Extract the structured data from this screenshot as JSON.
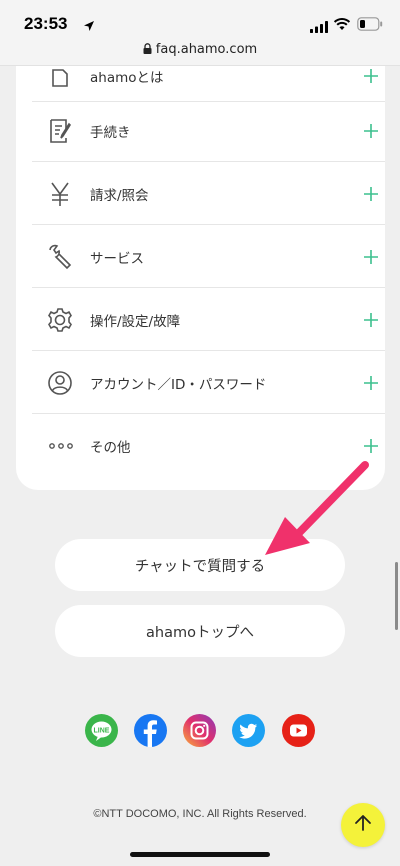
{
  "status": {
    "time": "23:53",
    "url": "faq.ahamo.com"
  },
  "menu": {
    "items": [
      {
        "label": "ahamoとは",
        "icon": "info-doc-icon"
      },
      {
        "label": "手続き",
        "icon": "form-icon"
      },
      {
        "label": "請求/照会",
        "icon": "yen-icon"
      },
      {
        "label": "サービス",
        "icon": "wrench-icon"
      },
      {
        "label": "操作/設定/故障",
        "icon": "gear-icon"
      },
      {
        "label": "アカウント／ID・パスワード",
        "icon": "user-icon"
      },
      {
        "label": "その他",
        "icon": "more-dots-icon"
      }
    ]
  },
  "buttons": {
    "chat": "チャットで質問する",
    "top": "ahamoトップへ"
  },
  "social": [
    "LINE",
    "facebook",
    "instagram",
    "twitter",
    "youtube"
  ],
  "footer": {
    "copyright": "©NTT DOCOMO, INC. All Rights Reserved."
  },
  "colors": {
    "accent_plus": "#3cc08e",
    "annotation_arrow": "#f0316b",
    "top_button": "#f4f23a"
  }
}
